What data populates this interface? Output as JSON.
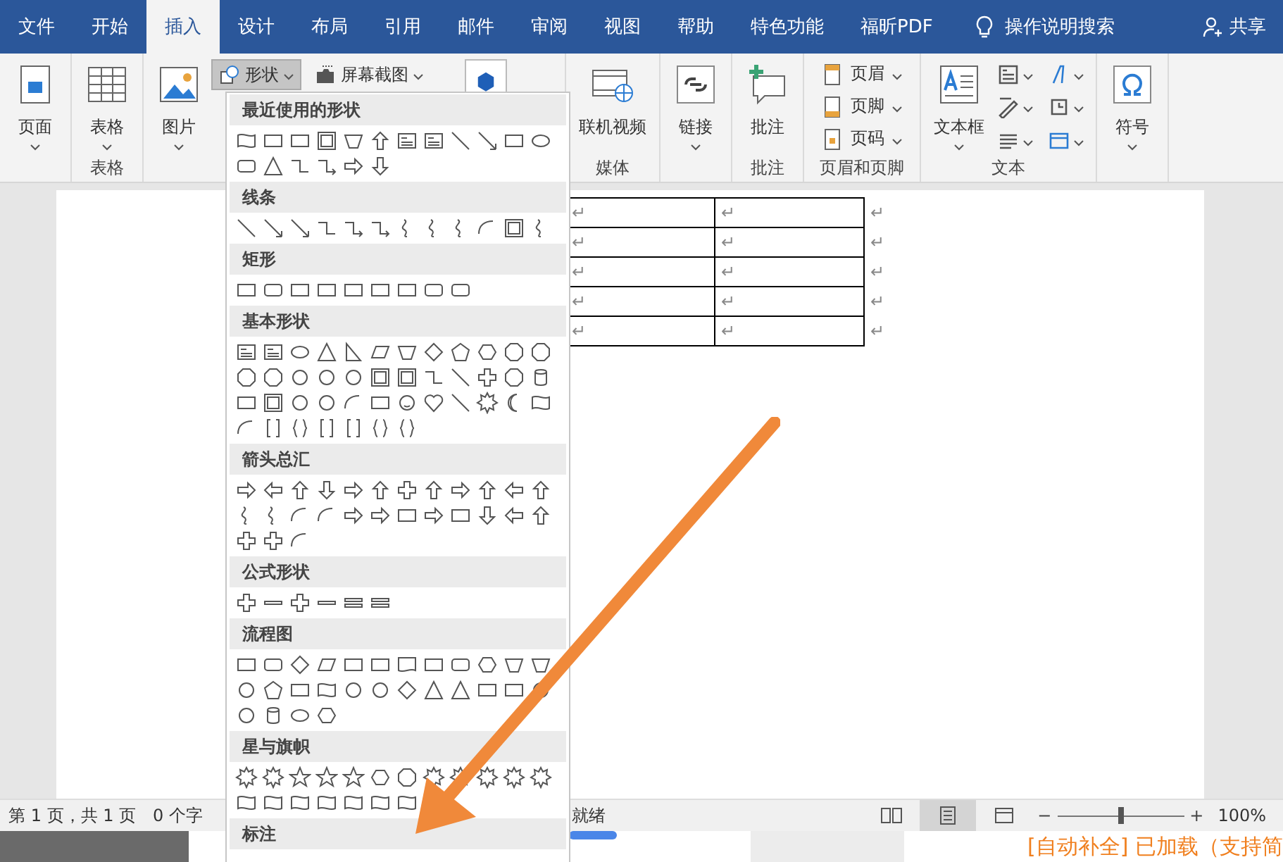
{
  "tabs": [
    {
      "label": "文件",
      "selected": false
    },
    {
      "label": "开始",
      "selected": false
    },
    {
      "label": "插入",
      "selected": true
    },
    {
      "label": "设计",
      "selected": false
    },
    {
      "label": "布局",
      "selected": false
    },
    {
      "label": "引用",
      "selected": false
    },
    {
      "label": "邮件",
      "selected": false
    },
    {
      "label": "审阅",
      "selected": false
    },
    {
      "label": "视图",
      "selected": false
    },
    {
      "label": "帮助",
      "selected": false
    },
    {
      "label": "特色功能",
      "selected": false
    },
    {
      "label": "福昕PDF",
      "selected": false
    }
  ],
  "tell_me": "操作说明搜索",
  "share": "共享",
  "ribbon_groups": [
    {
      "items": [
        {
          "kind": "large",
          "label": "页面",
          "caret": true
        }
      ]
    },
    {
      "label": "表格",
      "items": [
        {
          "kind": "large",
          "label": "表格",
          "caret": true
        }
      ]
    },
    {
      "items": [
        {
          "kind": "large",
          "label": "图片",
          "caret": true
        },
        {
          "kind": "small",
          "label": "形状",
          "caret": true,
          "selected": true
        },
        {
          "kind": "small",
          "label": "屏幕截图",
          "caret": true,
          "selected": false
        },
        {
          "kind": "cube"
        }
      ]
    },
    {
      "label": "媒体",
      "items": [
        {
          "kind": "large",
          "label": "联机视频",
          "caret": false
        }
      ]
    },
    {
      "items": [
        {
          "kind": "large",
          "label": "链接",
          "caret": true
        }
      ]
    },
    {
      "label": "批注",
      "items": [
        {
          "kind": "large",
          "label": "批注",
          "caret": false
        }
      ]
    },
    {
      "label": "页眉和页脚",
      "items": [
        {
          "kind": "stack",
          "rows": [
            {
              "label": "页眉"
            },
            {
              "label": "页脚"
            },
            {
              "label": "页码"
            }
          ]
        }
      ]
    },
    {
      "label": "文本",
      "items": [
        {
          "kind": "large",
          "label": "文本框",
          "caret": true
        },
        {
          "kind": "icons"
        }
      ]
    },
    {
      "items": [
        {
          "kind": "large",
          "label": "符号",
          "caret": true
        }
      ]
    }
  ],
  "shapes_menu": {
    "sections": [
      {
        "title": "最近使用的形状"
      },
      {
        "title": "线条"
      },
      {
        "title": "矩形"
      },
      {
        "title": "基本形状"
      },
      {
        "title": "箭头总汇"
      },
      {
        "title": "公式形状"
      },
      {
        "title": "流程图"
      },
      {
        "title": "星与旗帜"
      },
      {
        "title": "标注"
      }
    ]
  },
  "table": {
    "rows": [
      {
        "cells": [
          "↵",
          "↵"
        ],
        "end_mark": "↵"
      },
      {
        "cells": [
          "↵",
          "↵"
        ],
        "end_mark": "↵"
      },
      {
        "cells": [
          "↵",
          "↵"
        ],
        "end_mark": "↵"
      },
      {
        "cells": [
          "↵",
          "↵"
        ],
        "end_mark": "↵"
      },
      {
        "cells": [
          "↵",
          "↵"
        ],
        "end_mark": "↵"
      }
    ]
  },
  "status_bar": {
    "page": "第 1 页，共 1 页",
    "words": "0 个字",
    "state": "就绪",
    "views": [
      {
        "selected": false
      },
      {
        "selected": true
      },
      {
        "selected": false
      }
    ],
    "zoom": {
      "zoom_out": "−",
      "zoom_in": "+",
      "level": 0.5,
      "reading": "100%"
    }
  },
  "notice": "[自动补全] 已加载（支持简"
}
